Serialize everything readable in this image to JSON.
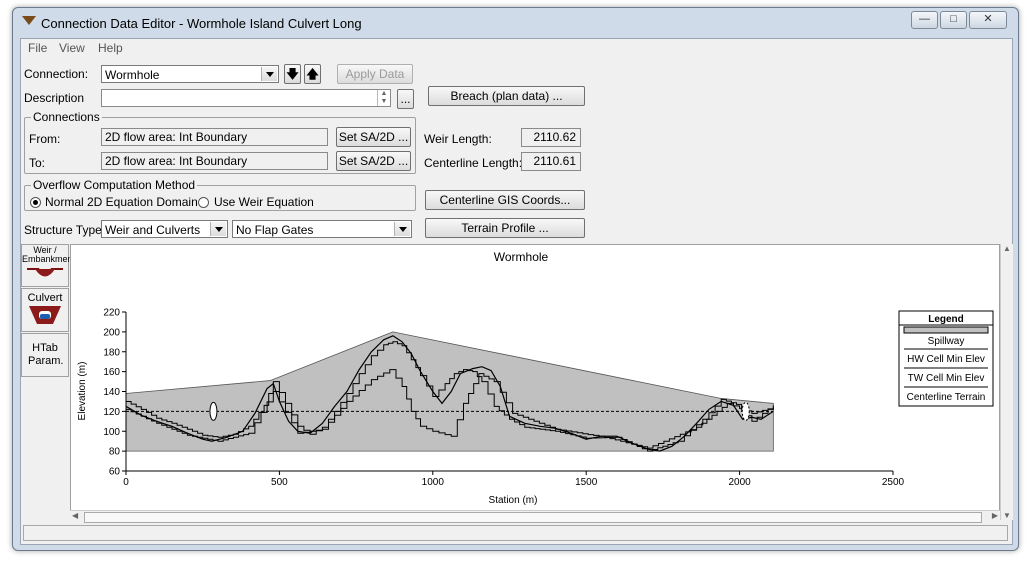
{
  "window": {
    "title": "Connection Data Editor - Wormhole Island Culvert Long",
    "controls": [
      "minimize-icon",
      "restore-icon",
      "close-icon"
    ]
  },
  "menu": [
    "File",
    "View",
    "Help"
  ],
  "form": {
    "connection_label": "Connection:",
    "connection_value": "Wormhole",
    "apply_data": "Apply Data",
    "description_label": "Description",
    "description_value": "",
    "ellipsis": "...",
    "breach_button": "Breach (plan data) ...",
    "connections_group": "Connections",
    "from_label": "From:",
    "from_value": "2D flow area: Int Boundary",
    "to_label": "To:",
    "to_value": "2D flow area: Int Boundary",
    "set_sa_label": "Set SA/2D ...",
    "weir_length_label": "Weir Length:",
    "weir_length_value": "2110.62",
    "centerline_length_label": "Centerline Length:",
    "centerline_length_value": "2110.61",
    "overflow_group": "Overflow Computation Method",
    "overflow_option1": "Normal 2D Equation Domain",
    "overflow_option2": "Use Weir Equation",
    "overflow_selected": "Normal 2D Equation Domain",
    "centerline_gis_button": "Centerline GIS Coords...",
    "structure_type_label": "Structure Type:",
    "structure_type_value": "Weir and Culverts",
    "flap_gates_value": "No Flap Gates",
    "terrain_profile_button": "Terrain Profile ..."
  },
  "side_tabs": {
    "weir": "Weir / Embankment",
    "culvert": "Culvert",
    "htab": "HTab Param."
  },
  "colors": {
    "fill": "#c0c0c0",
    "culvert_blue": "#1a5fb4",
    "weir_red": "#8b1a1a"
  },
  "chart_data": {
    "type": "area",
    "title": "Wormhole",
    "xlabel": "Station (m)",
    "ylabel": "Elevation (m)",
    "xlim": [
      0,
      2500
    ],
    "ylim": [
      60,
      220
    ],
    "xticks": [
      0,
      500,
      1000,
      1500,
      2000,
      2500
    ],
    "yticks": [
      60,
      80,
      100,
      120,
      140,
      160,
      180,
      200,
      220
    ],
    "spillway": {
      "x": [
        0,
        470,
        870,
        1940,
        2110
      ],
      "y": [
        138,
        151,
        200,
        133,
        128
      ],
      "base": 80,
      "x_end": 2110
    },
    "centerline_terrain": {
      "x": [
        0,
        50,
        100,
        150,
        200,
        250,
        280,
        330,
        380,
        420,
        460,
        480,
        500,
        530,
        560,
        600,
        640,
        680,
        720,
        760,
        800,
        840,
        870,
        900,
        930,
        960,
        1000,
        1030,
        1060,
        1090,
        1130,
        1160,
        1190,
        1220,
        1250,
        1300,
        1350,
        1400,
        1450,
        1500,
        1550,
        1600,
        1650,
        1700,
        1740,
        1780,
        1820,
        1860,
        1900,
        1940,
        1980,
        2010,
        2040,
        2070,
        2110
      ],
      "y": [
        125,
        116,
        110,
        105,
        98,
        92,
        90,
        94,
        100,
        118,
        143,
        148,
        130,
        110,
        100,
        98,
        108,
        125,
        140,
        162,
        180,
        192,
        196,
        190,
        178,
        160,
        140,
        128,
        140,
        158,
        163,
        165,
        161,
        145,
        115,
        108,
        105,
        103,
        98,
        92,
        95,
        95,
        88,
        82,
        80,
        85,
        95,
        108,
        122,
        130,
        126,
        112,
        114,
        112,
        120
      ]
    },
    "hw_cell_min_elev": {
      "x": [
        0,
        50,
        100,
        150,
        200,
        250,
        300,
        350,
        400,
        450,
        480,
        520,
        560,
        600,
        640,
        680,
        720,
        760,
        800,
        840,
        870,
        900,
        930,
        960,
        1000,
        1040,
        1070,
        1100,
        1130,
        1160,
        1200,
        1250,
        1300,
        1400,
        1500,
        1600,
        1700,
        1800,
        1880,
        1940,
        1990,
        2040,
        2110
      ],
      "y": [
        130,
        122,
        113,
        108,
        102,
        96,
        94,
        97,
        105,
        126,
        150,
        128,
        105,
        97,
        104,
        120,
        138,
        158,
        176,
        187,
        190,
        186,
        172,
        156,
        135,
        148,
        158,
        162,
        160,
        150,
        125,
        112,
        104,
        100,
        93,
        94,
        80,
        90,
        112,
        132,
        127,
        110,
        126
      ]
    },
    "tw_cell_min_elev": {
      "x": [
        0,
        100,
        200,
        300,
        400,
        480,
        560,
        640,
        720,
        800,
        860,
        900,
        930,
        960,
        1000,
        1060,
        1100,
        1150,
        1200,
        1260,
        1400,
        1560,
        1700,
        1860,
        1960,
        2040,
        2110
      ],
      "y": [
        122,
        108,
        96,
        90,
        98,
        140,
        98,
        102,
        130,
        152,
        162,
        145,
        120,
        105,
        100,
        95,
        128,
        158,
        150,
        118,
        102,
        94,
        83,
        104,
        128,
        118,
        124
      ]
    },
    "water_level_line": {
      "x": [
        0,
        2110
      ],
      "y": [
        120,
        120
      ]
    },
    "culvert_openings": [
      {
        "x": 285,
        "y": 120
      },
      {
        "x": 2020,
        "y": 120
      }
    ],
    "legend": {
      "title": "Legend",
      "entries": [
        "Spillway",
        "HW Cell Min Elev",
        "TW Cell Min Elev",
        "Centerline Terrain"
      ],
      "placement": "right"
    }
  }
}
